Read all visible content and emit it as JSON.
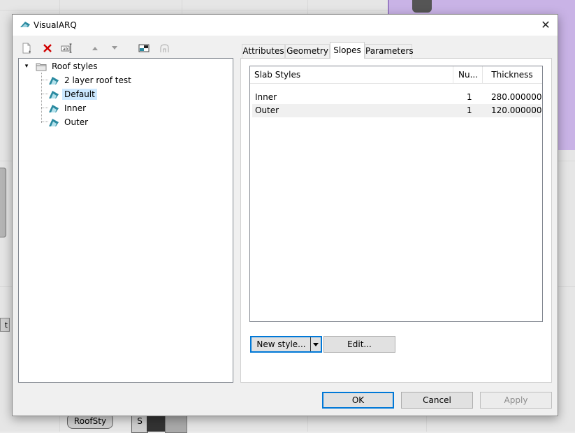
{
  "background": {
    "node_left_label": "t",
    "roof_node_label": "RoofSty",
    "s_node_label": "S"
  },
  "dialog": {
    "title": "VisualARQ",
    "close_glyph": "✕"
  },
  "toolbar": {
    "icons": [
      "new-icon",
      "delete-icon",
      "rename-icon",
      "move-up-icon",
      "move-down-icon",
      "preview-icon",
      "export-icon"
    ]
  },
  "tree": {
    "root_label": "Roof styles",
    "root_expander": "▾",
    "items": [
      {
        "label": "2 layer roof test",
        "selected": false
      },
      {
        "label": "Default",
        "selected": true
      },
      {
        "label": "Inner",
        "selected": false
      },
      {
        "label": "Outer",
        "selected": false
      }
    ]
  },
  "tabs": [
    {
      "label": "Attributes",
      "active": false
    },
    {
      "label": "Geometry",
      "active": false
    },
    {
      "label": "Slopes",
      "active": true
    },
    {
      "label": "Parameters",
      "active": false
    }
  ],
  "slab_list": {
    "columns": [
      "Slab Styles",
      "Nu...",
      "Thickness"
    ],
    "rows": [
      {
        "name": "Inner",
        "number": "1",
        "thickness": "280.000000"
      },
      {
        "name": "Outer",
        "number": "1",
        "thickness": "120.000000"
      }
    ]
  },
  "panel_buttons": {
    "new_style": "New style...",
    "edit": "Edit..."
  },
  "footer": {
    "ok": "OK",
    "cancel": "Cancel",
    "apply": "Apply"
  },
  "colors": {
    "accent": "#0078d7",
    "selection": "#cce8ff",
    "delete_red": "#d00000",
    "icon_teal": "#2a8aa0"
  }
}
